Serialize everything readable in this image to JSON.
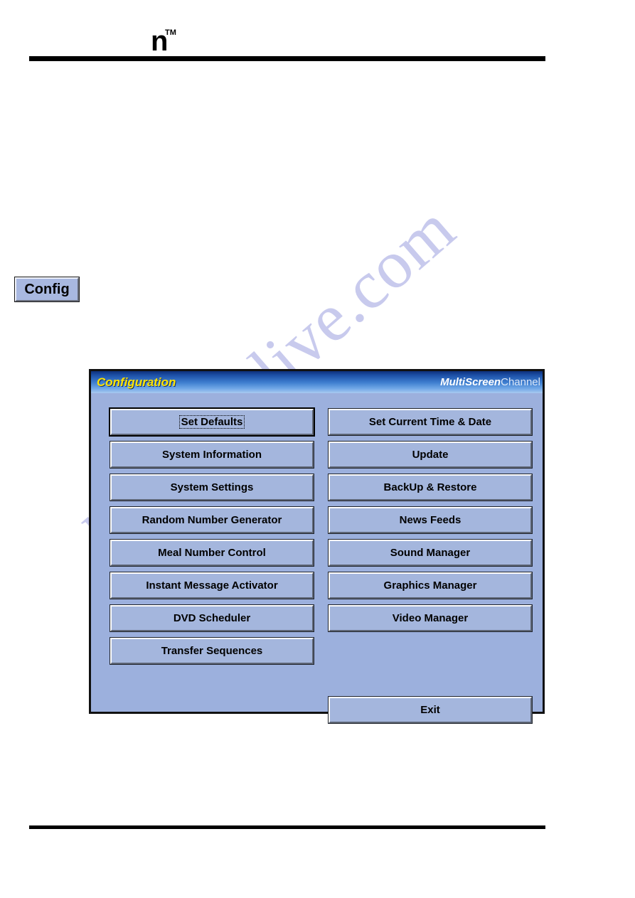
{
  "page": {
    "brand_logo": "n",
    "brand_tm": "TM"
  },
  "watermark": {
    "text": "manualslive.com"
  },
  "standalone": {
    "config_button_label": "Config"
  },
  "window": {
    "title": "Configuration",
    "product_name_bold": "MultiScreen",
    "product_name_light": "Channel",
    "colors": {
      "title_text": "#ffe400",
      "titlebar_dark": "#0d2f7a",
      "titlebar_light": "#a8c8f0",
      "window_background": "#9cb0dd",
      "button_face": "#a4b6dd"
    },
    "left_column": [
      {
        "label": "Set Defaults",
        "name": "set-defaults",
        "default": true
      },
      {
        "label": "System Information",
        "name": "system-information",
        "default": false
      },
      {
        "label": "System Settings",
        "name": "system-settings",
        "default": false
      },
      {
        "label": "Random Number Generator",
        "name": "random-number-generator",
        "default": false
      },
      {
        "label": "Meal Number Control",
        "name": "meal-number-control",
        "default": false
      },
      {
        "label": "Instant Message Activator",
        "name": "instant-message-activator",
        "default": false
      },
      {
        "label": "DVD Scheduler",
        "name": "dvd-scheduler",
        "default": false
      },
      {
        "label": "Transfer Sequences",
        "name": "transfer-sequences",
        "default": false
      }
    ],
    "right_column": [
      {
        "label": "Set Current Time & Date",
        "name": "set-current-time-and-date",
        "default": false
      },
      {
        "label": "Update",
        "name": "update",
        "default": false
      },
      {
        "label": "BackUp & Restore",
        "name": "backup-and-restore",
        "default": false
      },
      {
        "label": "News Feeds",
        "name": "news-feeds",
        "default": false
      },
      {
        "label": "Sound Manager",
        "name": "sound-manager",
        "default": false
      },
      {
        "label": "Graphics Manager",
        "name": "graphics-manager",
        "default": false
      },
      {
        "label": "Video Manager",
        "name": "video-manager",
        "default": false
      }
    ],
    "exit_button": {
      "label": "Exit",
      "name": "exit"
    }
  }
}
